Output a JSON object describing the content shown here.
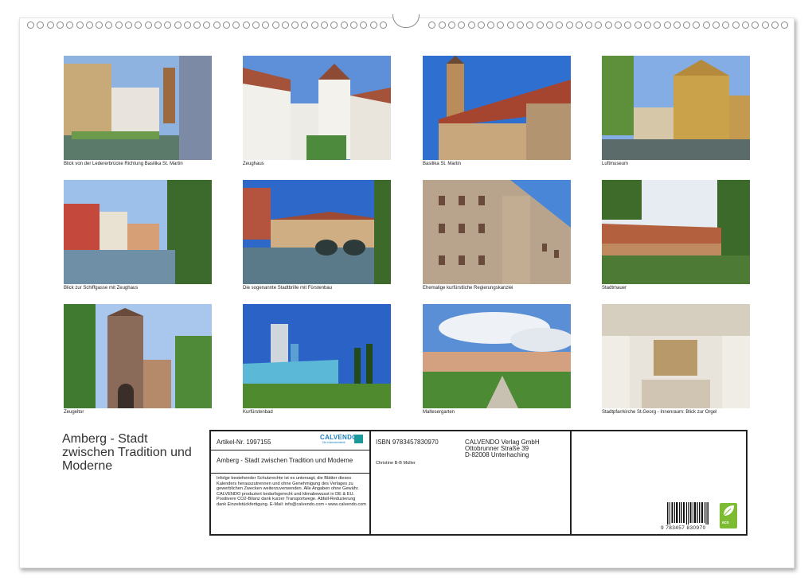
{
  "calendar": {
    "title": "Amberg - Stadt zwischen Tradition und Moderne",
    "photos": [
      {
        "caption": "Blick von der Ledererbrücke Richtung Basilika St. Martin"
      },
      {
        "caption": "Zeughaus"
      },
      {
        "caption": "Basilika St. Martin"
      },
      {
        "caption": "Luftmuseum"
      },
      {
        "caption": "Blick zur Schiffgasse mit Zeughaus"
      },
      {
        "caption": "Die sogenannte Stadtbrille mit Fürstenbau"
      },
      {
        "caption": "Ehemalige kurfürstliche Regierungskanzlei"
      },
      {
        "caption": "Stadtmauer"
      },
      {
        "caption": "Zeugeltor"
      },
      {
        "caption": "Kurfürstenbad"
      },
      {
        "caption": "Maltesergarten"
      },
      {
        "caption": "Stadtpfarrkirche St.Georg - Innenraum: Blick zur Orgel"
      }
    ]
  },
  "info": {
    "article_no": "Artikel-Nr. 1997155",
    "logo_text": "CALVENDO",
    "logo_sub": "Die Kalenderfabrik",
    "product_title": "Amberg - Stadt zwischen Tradition und Moderne",
    "legal_text": "Infolge bestehender Schutzrechte ist es untersagt, die Blätter dieses Kalenders herauszutrennen und ohne Genehmigung des Verlages zu gewerblichen Zwecken weiterzuverwenden. Alle Angaben ohne Gewähr. CALVENDO produziert bedarfsgerecht und klimabewusst in DE & EU. Positivere CO2-Bilanz dank kurzer Transportwege. Abfall-Reduzierung dank Einzelstückfertigung. E-Mail: info@calvendo.com • www.calvendo.com",
    "isbn": "ISBN 9783457830970",
    "author": "Christine B-B Müller",
    "publisher_name": "CALVENDO Verlag GmbH",
    "publisher_street": "Ottobrunner Straße 39",
    "publisher_city": "D-82008 Unterhaching",
    "barcode_number": "9 783457 830970",
    "eco_label": "eco"
  }
}
